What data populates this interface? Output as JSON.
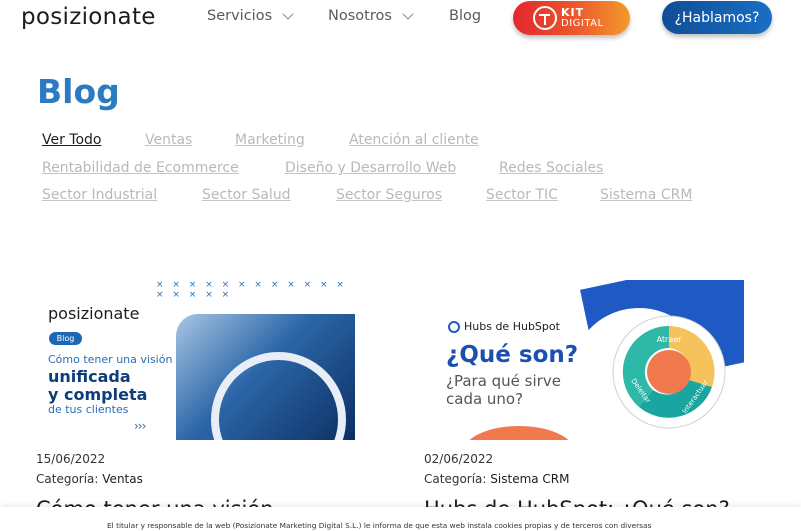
{
  "header": {
    "logo": "posizionate",
    "nav": [
      {
        "label": "Servicios",
        "has_dropdown": true
      },
      {
        "label": "Nosotros",
        "has_dropdown": true
      },
      {
        "label": "Blog",
        "has_dropdown": false
      }
    ],
    "kit_digital": {
      "line1": "KIT",
      "line2": "DIGITAL"
    },
    "cta_label": "¿Hablamos?",
    "colors": {
      "accent": "#2a7bc1",
      "cta": "#0f4e96",
      "kit": "#e3262d"
    }
  },
  "page": {
    "title": "Blog"
  },
  "filters": {
    "row1": [
      "Ver Todo",
      "Ventas",
      "Marketing",
      "Atención al cliente"
    ],
    "row2": [
      "Rentabilidad de Ecommerce",
      "Diseño y Desarrollo Web",
      "Redes Sociales"
    ],
    "row3": [
      "Sector Industrial",
      "Sector Salud",
      "Sector Seguros",
      "Sector TIC",
      "Sistema CRM"
    ],
    "active": "Ver Todo"
  },
  "posts": [
    {
      "date": "15/06/2022",
      "category_label": "Categoría:",
      "category": "Ventas",
      "title_peek": "Cómo tener una visión",
      "image": {
        "logo": "posizionate",
        "badge": "Blog",
        "line1": "Cómo tener una visión",
        "line2": "unificada",
        "line3": "y completa",
        "line4": "de tus clientes"
      }
    },
    {
      "date": "02/06/2022",
      "category_label": "Categoría:",
      "category": "Sistema CRM",
      "title_peek": "Hubs de HubSpot: ¿Qué son?",
      "image": {
        "brand": "Hubs de HubSpot",
        "line1": "¿Qué son?",
        "line2": "¿Para qué sirve",
        "line3": "cada uno?",
        "wheel": {
          "top": "Atraer",
          "right": "Interactuar",
          "left": "Deleitar"
        }
      }
    }
  ],
  "cookie_notice": {
    "text": "El titular y responsable de la web (Posizionate Marketing Digital S.L.) le informa de que esta web instala cookies propias y de terceros con diversas"
  }
}
